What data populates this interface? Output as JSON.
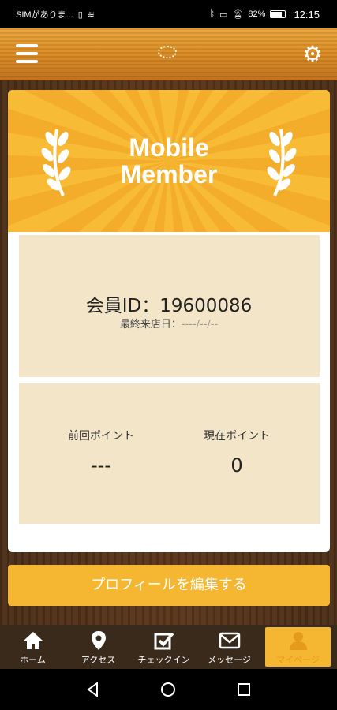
{
  "status_bar": {
    "carrier": "SIMがありま...",
    "battery": "82%",
    "time": "12:15"
  },
  "banner": {
    "line1": "Mobile",
    "line2": "Member"
  },
  "member": {
    "id_label": "会員ID：19600086",
    "last_visit_label": "最終来店日：",
    "last_visit_value": "----/--/--"
  },
  "points": {
    "previous_label": "前回ポイント",
    "previous_value": "---",
    "current_label": "現在ポイント",
    "current_value": "0"
  },
  "profile_button": "プロフィールを編集する",
  "tabs": [
    {
      "label": "ホーム",
      "icon": "home-icon"
    },
    {
      "label": "アクセス",
      "icon": "map-pin-icon"
    },
    {
      "label": "チェックイン",
      "icon": "checkin-icon"
    },
    {
      "label": "メッセージ",
      "icon": "mail-icon"
    },
    {
      "label": "マイページ",
      "icon": "user-icon"
    }
  ],
  "colors": {
    "accent": "#f5b731",
    "card_fill": "#f3e5c8",
    "wood": "#4a2d16"
  }
}
